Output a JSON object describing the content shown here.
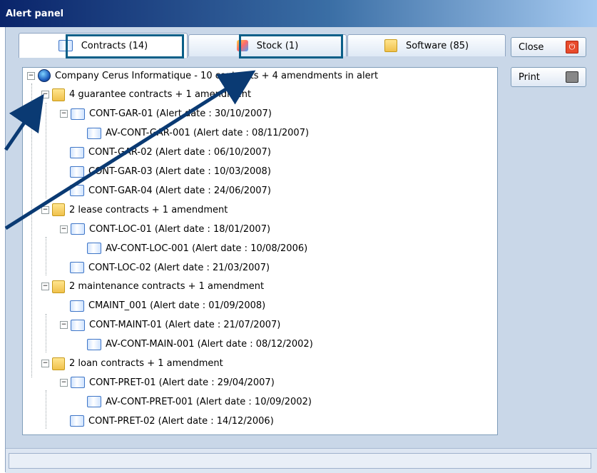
{
  "window": {
    "title": "Alert panel"
  },
  "tabs": [
    {
      "label": "Contracts (14)",
      "icon": "book-icon",
      "active": true
    },
    {
      "label": "Stock (1)",
      "icon": "stock-icon",
      "active": false
    },
    {
      "label": "Software (85)",
      "icon": "software-icon",
      "active": false
    }
  ],
  "buttons": {
    "close": "Close",
    "print": "Print"
  },
  "tree": [
    {
      "label": "Company Cerus Informatique - 10 contracts + 4 amendments in alert",
      "type": "root"
    },
    {
      "label": "4 guarantee contracts + 1 amendment",
      "type": "folder"
    },
    {
      "label": "CONT-GAR-01 (Alert date : 30/10/2007)",
      "type": "book"
    },
    {
      "label": "AV-CONT-GAR-001 (Alert date : 08/11/2007)",
      "type": "book"
    },
    {
      "label": "CONT-GAR-02 (Alert date : 06/10/2007)",
      "type": "book"
    },
    {
      "label": "CONT-GAR-03 (Alert date : 10/03/2008)",
      "type": "book"
    },
    {
      "label": "CONT-GAR-04 (Alert date : 24/06/2007)",
      "type": "book"
    },
    {
      "label": "2 lease contracts + 1 amendment",
      "type": "folder"
    },
    {
      "label": "CONT-LOC-01 (Alert date : 18/01/2007)",
      "type": "book"
    },
    {
      "label": "AV-CONT-LOC-001 (Alert date : 10/08/2006)",
      "type": "book"
    },
    {
      "label": "CONT-LOC-02 (Alert date : 21/03/2007)",
      "type": "book"
    },
    {
      "label": "2 maintenance contracts + 1 amendment",
      "type": "folder"
    },
    {
      "label": "CMAINT_001 (Alert date : 01/09/2008)",
      "type": "book"
    },
    {
      "label": "CONT-MAINT-01 (Alert date : 21/07/2007)",
      "type": "book"
    },
    {
      "label": "AV-CONT-MAIN-001 (Alert date : 08/12/2002)",
      "type": "book"
    },
    {
      "label": "2 loan contracts + 1 amendment",
      "type": "folder"
    },
    {
      "label": "CONT-PRET-01 (Alert date : 29/04/2007)",
      "type": "book"
    },
    {
      "label": "AV-CONT-PRET-001 (Alert date : 10/09/2002)",
      "type": "book"
    },
    {
      "label": "CONT-PRET-02 (Alert date : 14/12/2006)",
      "type": "book"
    }
  ],
  "colors": {
    "highlight_box": "#0a5f88",
    "arrow": "#0a3a73"
  }
}
